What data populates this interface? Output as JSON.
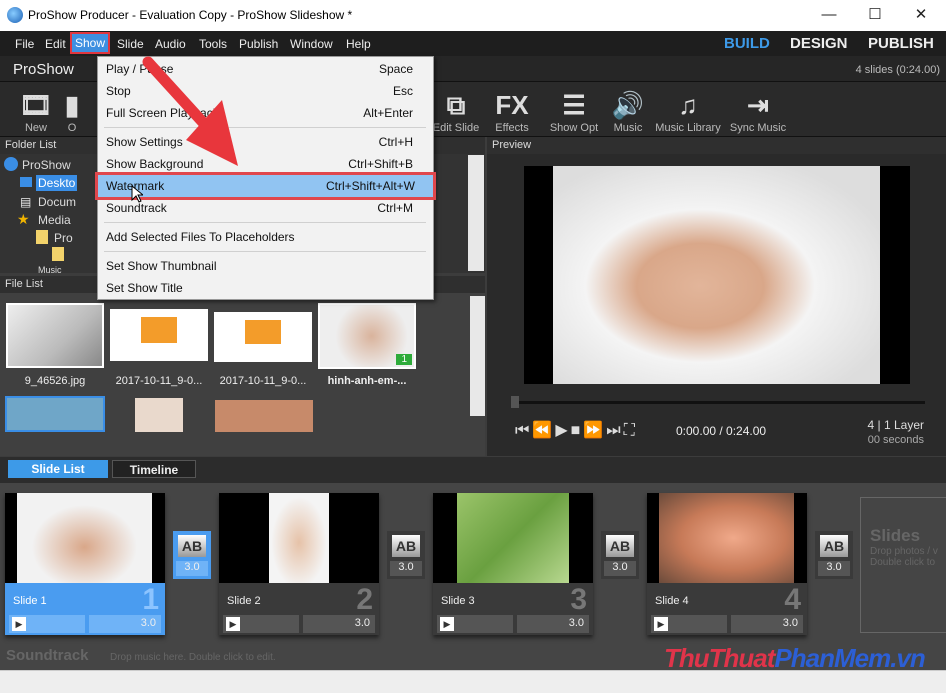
{
  "window": {
    "title": "ProShow Producer - Evaluation Copy - ProShow Slideshow *",
    "minimize": "—",
    "maximize": "☐",
    "close": "✕"
  },
  "menubar": {
    "items": [
      "File",
      "Edit",
      "Show",
      "Slide",
      "Audio",
      "Tools",
      "Publish",
      "Window",
      "Help"
    ],
    "modes": [
      "BUILD",
      "DESIGN",
      "PUBLISH"
    ],
    "active_mode_color": "#3d9ae8"
  },
  "header": {
    "app": "ProShow",
    "summary": "4 slides (0:24.00)"
  },
  "toolbar": {
    "items": [
      {
        "label": "New",
        "icon": "new-show-icon"
      },
      {
        "label": "O",
        "icon": "open-icon"
      },
      {
        "label": "Edit Slide",
        "icon": "edit-slide-icon"
      },
      {
        "label": "Effects",
        "icon": "fx-icon"
      },
      {
        "label": "Show Opt",
        "icon": "show-options-icon"
      },
      {
        "label": "Music",
        "icon": "speaker-icon"
      },
      {
        "label": "Music Library",
        "icon": "music-library-icon"
      },
      {
        "label": "Sync Music",
        "icon": "sync-music-icon"
      }
    ]
  },
  "folder_list": {
    "title": "Folder List",
    "items": [
      "ProShow",
      "Deskto",
      "Docum",
      "Media",
      "Pro",
      "Music"
    ]
  },
  "file_list": {
    "title": "File List",
    "files": [
      "9_46526.jpg",
      "2017-10-11_9-0...",
      "2017-10-11_9-0...",
      "hinh-anh-em-..."
    ],
    "badge": "1"
  },
  "preview": {
    "title": "Preview",
    "time": "0:00.00 / 0:24.00",
    "info1": "4 | 1 Layer",
    "info2": "00 seconds"
  },
  "tabs": [
    "Slide List",
    "Timeline"
  ],
  "slides": [
    {
      "name": "Slide 1",
      "num": "1",
      "dur": "3.0",
      "trans": "3.0"
    },
    {
      "name": "Slide 2",
      "num": "2",
      "dur": "3.0",
      "trans": "3.0"
    },
    {
      "name": "Slide 3",
      "num": "3",
      "dur": "3.0",
      "trans": "3.0"
    },
    {
      "name": "Slide 4",
      "num": "4",
      "dur": "3.0",
      "trans": "3.0"
    }
  ],
  "slides_drop": {
    "title": "Slides",
    "line1": "Drop photos / v",
    "line2": "Double click to"
  },
  "soundtrack": {
    "title": "Soundtrack",
    "hint": "Drop music here.  Double click to edit."
  },
  "show_menu": {
    "items": [
      {
        "label": "Play / Pause",
        "shortcut": "Space"
      },
      {
        "label": "Stop",
        "shortcut": "Esc"
      },
      {
        "label": "Full Screen Playback",
        "shortcut": "Alt+Enter"
      },
      {
        "label": "Show Settings",
        "shortcut": "Ctrl+H"
      },
      {
        "label": "Show Background",
        "shortcut": "Ctrl+Shift+B"
      },
      {
        "label": "Watermark",
        "shortcut": "Ctrl+Shift+Alt+W"
      },
      {
        "label": "Soundtrack",
        "shortcut": "Ctrl+M"
      },
      {
        "label": "Add Selected Files To Placeholders",
        "shortcut": ""
      },
      {
        "label": "Set Show Thumbnail",
        "shortcut": ""
      },
      {
        "label": "Set Show Title",
        "shortcut": ""
      }
    ]
  },
  "watermark": "ThuThuatPhanMem.vn"
}
